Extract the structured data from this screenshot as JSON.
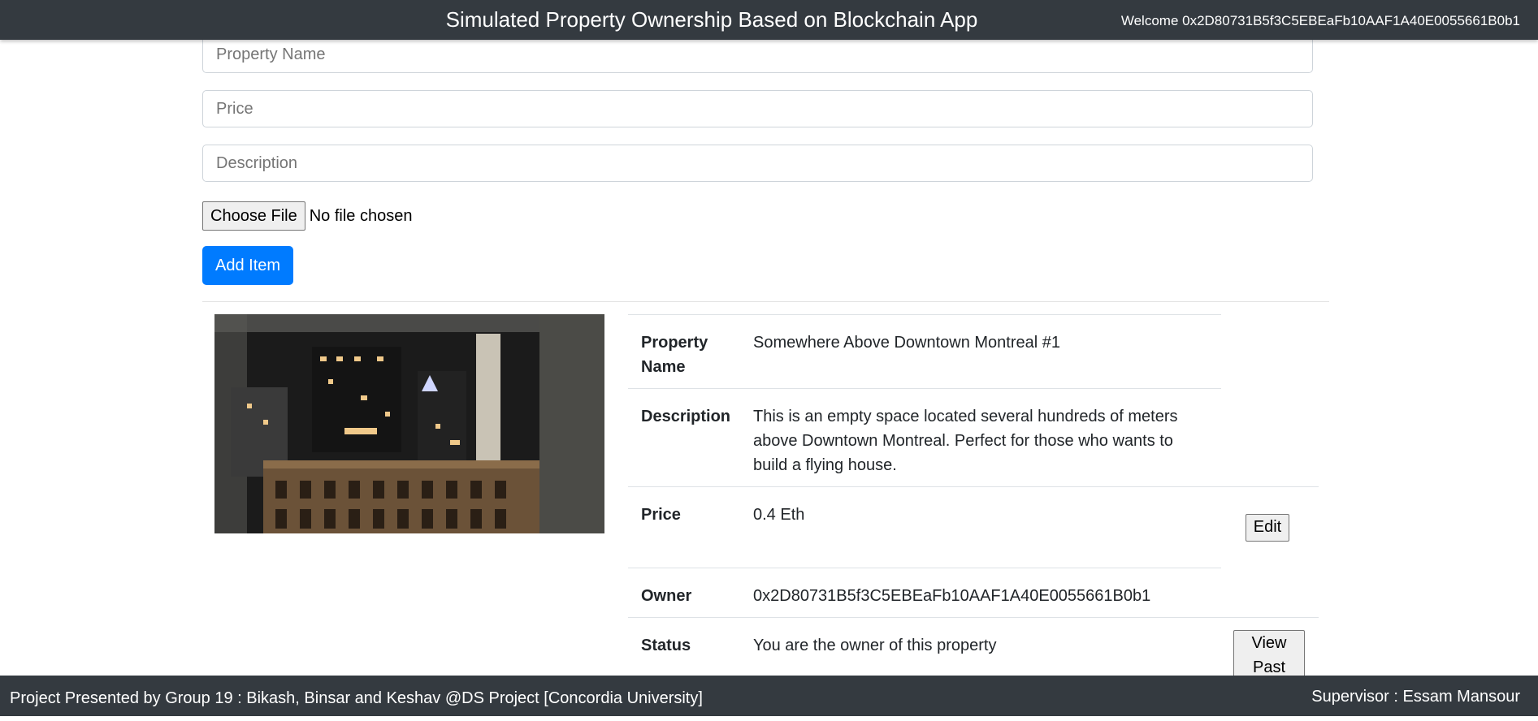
{
  "header": {
    "title": "Simulated Property Ownership Based on Blockchain App",
    "welcome": "Welcome 0x2D80731B5f3C5EBEaFb10AAF1A40E0055661B0b1"
  },
  "form": {
    "property_name_placeholder": "Property Name",
    "price_placeholder": "Price",
    "description_placeholder": "Description",
    "choose_file_label": "Choose File",
    "file_status": "No file chosen",
    "add_item_label": "Add Item"
  },
  "property": {
    "name_label": "Property Name",
    "name": "Somewhere Above Downtown Montreal #1",
    "description_label": "Description",
    "description": "This is an empty space located several hundreds of meters above Downtown Montreal. Perfect for those who wants to build a flying house.",
    "price_label": "Price",
    "price": "0.4 Eth",
    "edit_label": "Edit",
    "owner_label": "Owner",
    "owner": "0x2D80731B5f3C5EBEaFb10AAF1A40E0055661B0b1",
    "status_label": "Status",
    "status": "You are the owner of this property",
    "view_past_label": "View Past"
  },
  "footer": {
    "credits": "Project Presented by Group 19 : Bikash, Binsar and Keshav @DS Project [Concordia University]",
    "supervisor": "Supervisor : Essam Mansour"
  }
}
